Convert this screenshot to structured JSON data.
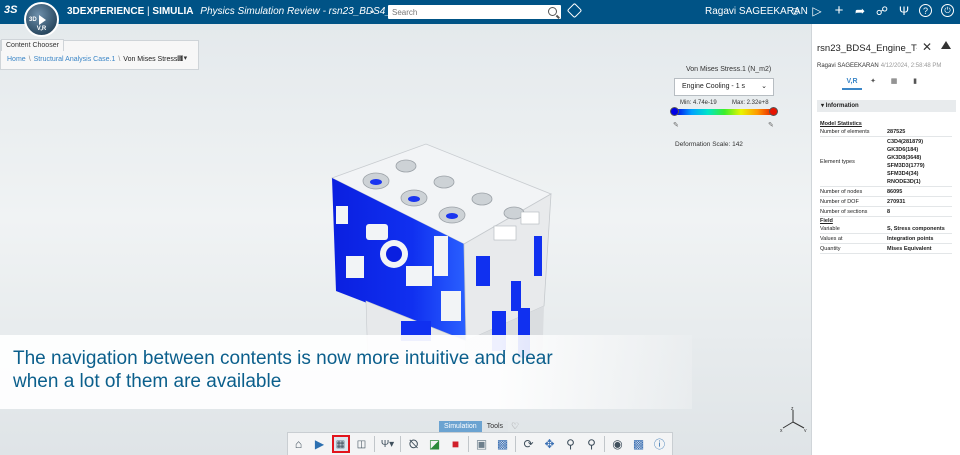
{
  "app": {
    "brand_prefix": "3DEXPERIENCE",
    "brand_sep": " | ",
    "brand_app": "SIMULIA",
    "document_title": "Physics Simulation Review - rsn23_BDS4_Engine_T-S...",
    "compass_version": "V,R",
    "compass_label": "3D",
    "ds_logo": "3S"
  },
  "search": {
    "placeholder": "Search"
  },
  "user": {
    "name": "Ragavi SAGEEKARAN"
  },
  "content_chooser": {
    "heading": "Content Chooser",
    "breadcrumb": [
      "Home",
      "Structural Analysis Case.1",
      "Von Mises Stress.1"
    ]
  },
  "legend": {
    "title": "Von Mises Stress.1 (N_m2)",
    "selected_step": "Engine Cooling - 1 s",
    "min_label": "Min: 4.74e-19",
    "max_label": "Max: 2.32e+8",
    "deformation": "Deformation Scale: 142",
    "colors": {
      "min": "#0000e6",
      "max": "#e61400"
    }
  },
  "caption": {
    "text": "The navigation between contents is now more intuitive and clear when a lot of them are available"
  },
  "toolbar": {
    "tabs": [
      "Simulation",
      "Tools"
    ],
    "active_tab": "Simulation",
    "selected_tool": "content-chooser-tool",
    "tools": [
      "home-icon",
      "play-icon",
      "content-chooser-tool",
      "capture-icon",
      "function-icon",
      "section-icon",
      "contour-icon",
      "color-icon",
      "mesh-icon",
      "sensor-icon",
      "rotate-icon",
      "pan-icon",
      "zoom-area-icon",
      "zoom-icon",
      "view-icon",
      "cube-view-icon",
      "info-icon"
    ]
  },
  "panel": {
    "title": "rsn23_BDS4_Engine_T-...",
    "owner": "Ragavi SAGEEKARAN",
    "date": "4/12/2024, 2:58:48 PM",
    "tabs": [
      "V,R",
      "links-icon",
      "table-icon",
      "comment-icon"
    ],
    "info_header": "Information",
    "model_statistics_label": "Model Statistics",
    "stats": [
      {
        "key": "Number of elements",
        "value": "287525"
      },
      {
        "key": "Element types",
        "value": "C3D4(281879)\nGK3D6(184)\nGK3D8(3648)\nSFM3D3(1779)\nSFM3D4(34)\nRNODE3D(1)"
      },
      {
        "key": "Number of nodes",
        "value": "86095"
      },
      {
        "key": "Number of DOF",
        "value": "270931"
      },
      {
        "key": "Number of sections",
        "value": "8"
      }
    ],
    "field_label": "Field",
    "field": [
      {
        "key": "Variable",
        "value": "S, Stress components"
      },
      {
        "key": "Values at",
        "value": "Integration points"
      },
      {
        "key": "Quantity",
        "value": "Mises Equivalent"
      }
    ]
  }
}
